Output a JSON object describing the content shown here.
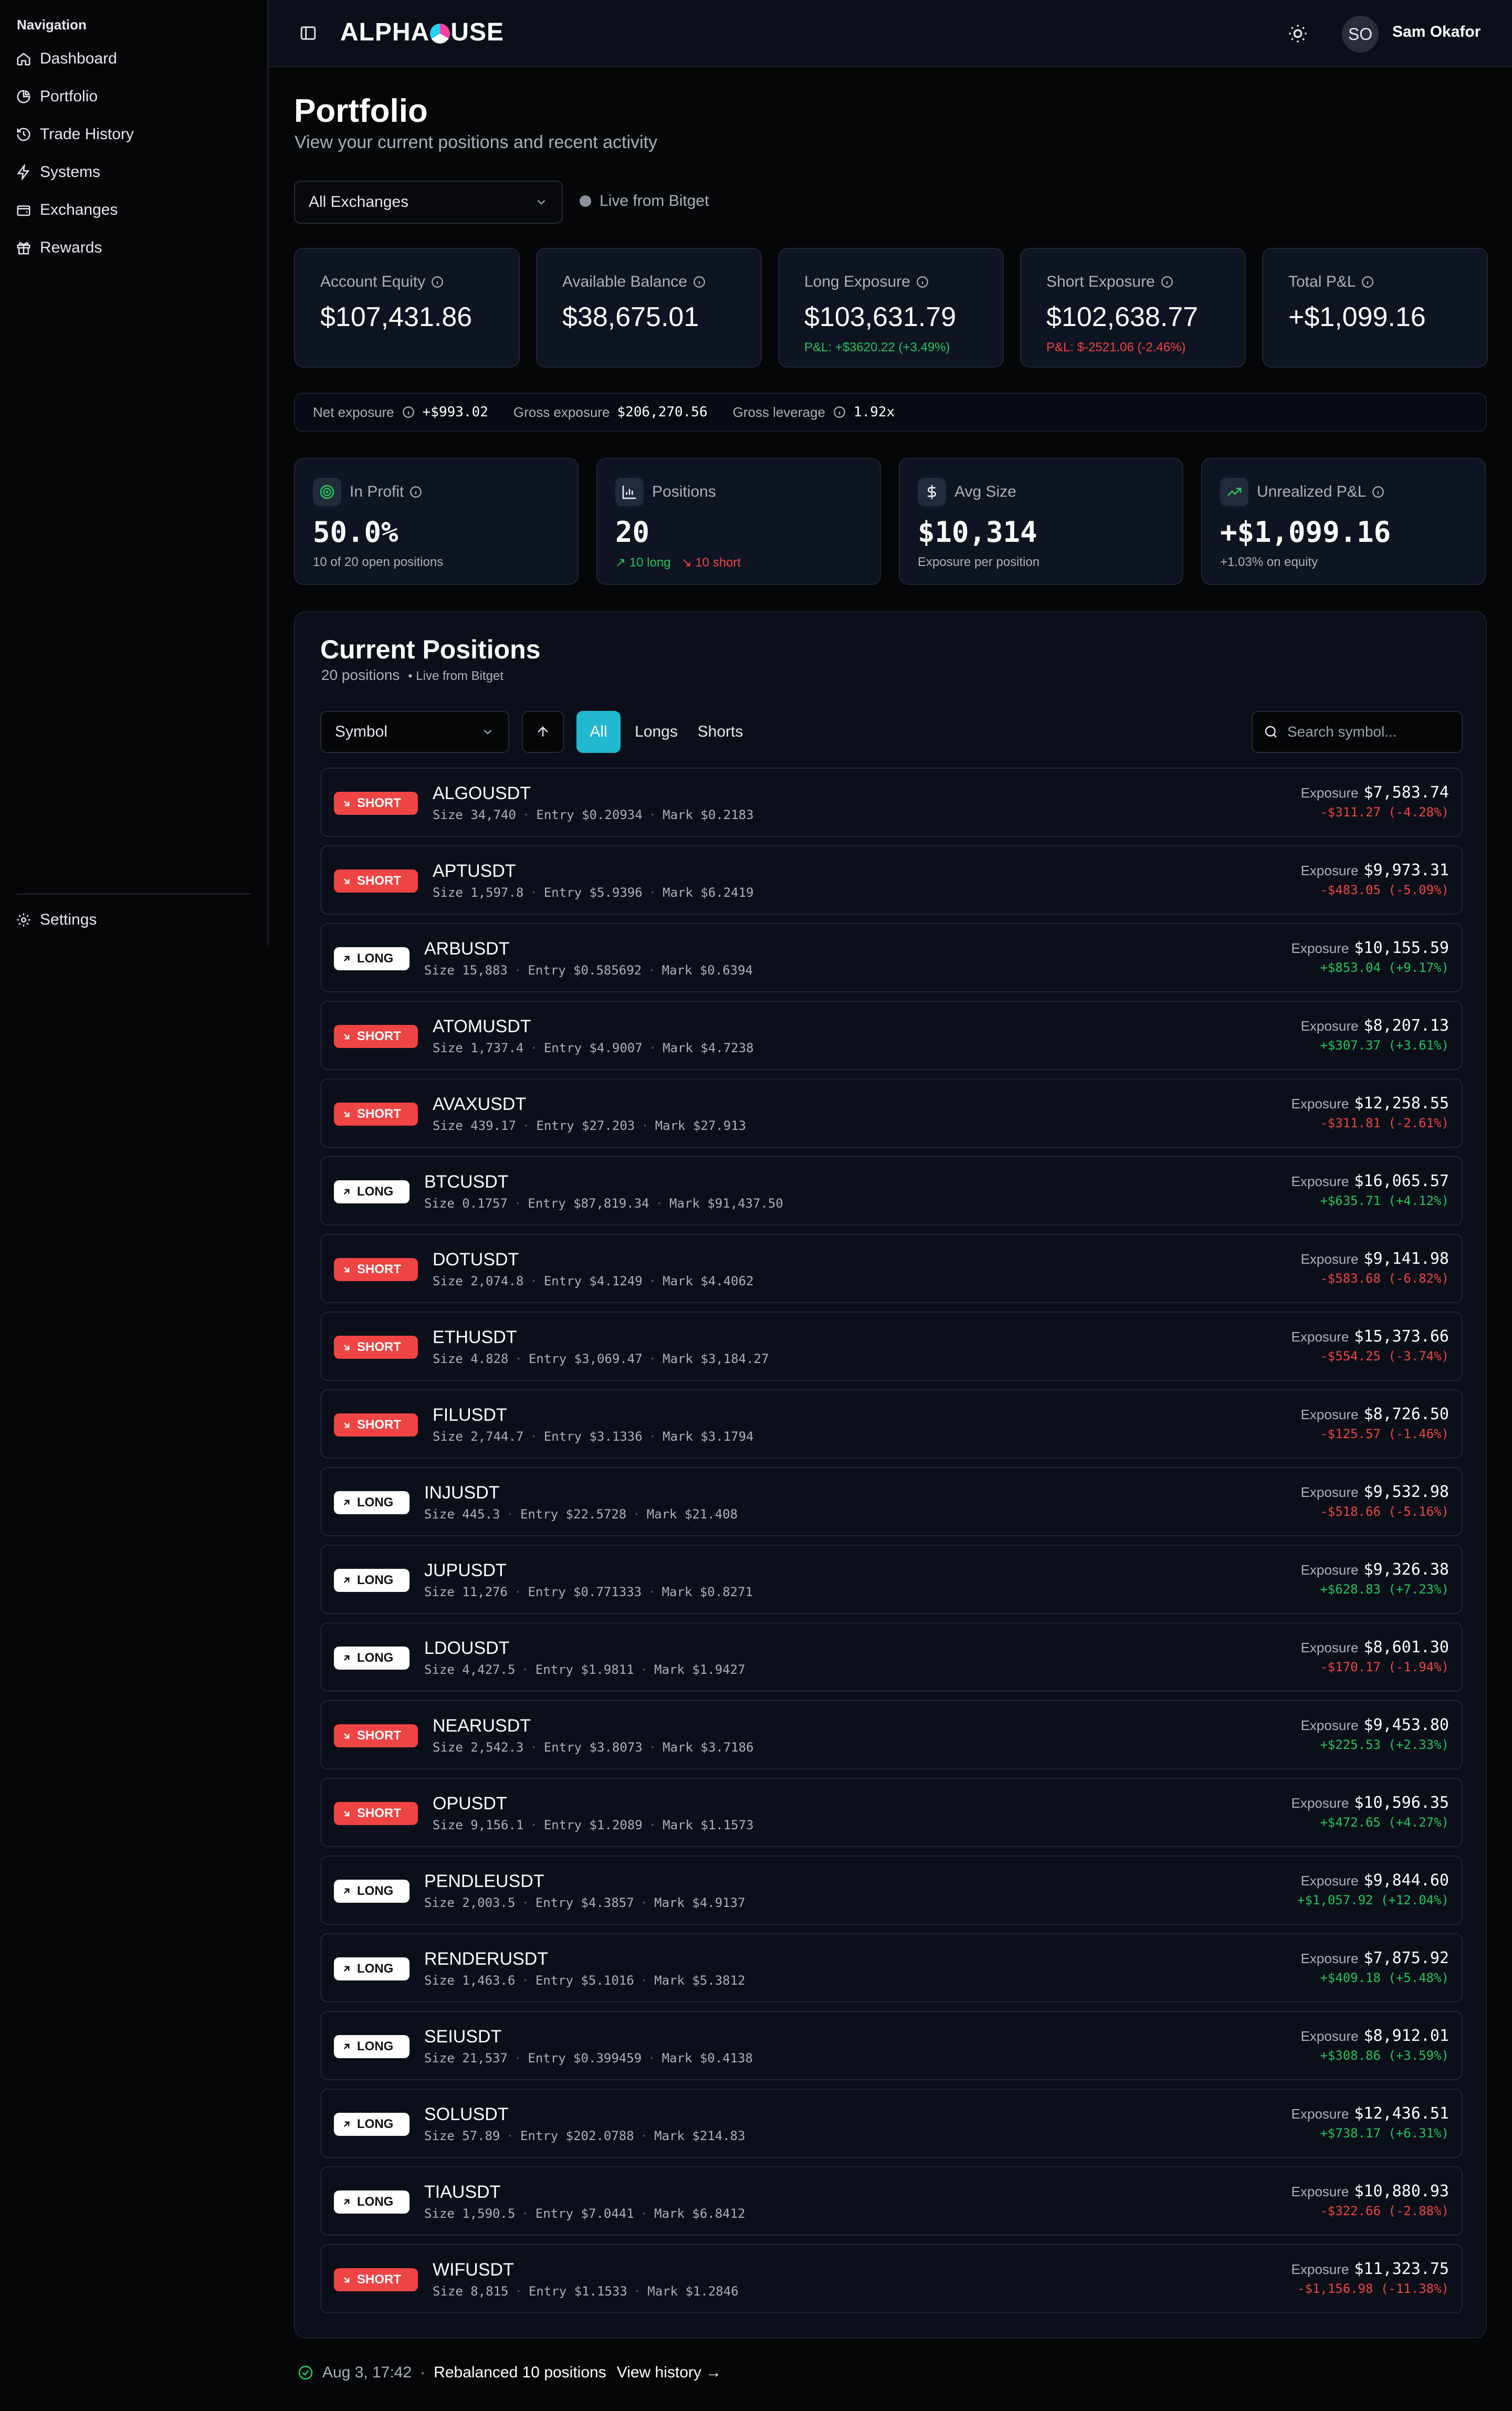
{
  "sidebar": {
    "heading": "Navigation",
    "items": [
      {
        "label": "Dashboard",
        "icon": "home-icon"
      },
      {
        "label": "Portfolio",
        "icon": "pie-chart-icon"
      },
      {
        "label": "Trade History",
        "icon": "history-icon"
      },
      {
        "label": "Systems",
        "icon": "zap-icon"
      },
      {
        "label": "Exchanges",
        "icon": "wallet-icon"
      },
      {
        "label": "Rewards",
        "icon": "gift-icon"
      }
    ],
    "settings": "Settings"
  },
  "header": {
    "logo_left": "ALPHA",
    "logo_right": "USE",
    "avatar": "SO",
    "user": "Sam Okafor"
  },
  "page": {
    "title": "Portfolio",
    "subtitle": "View your current positions and recent activity",
    "exchange_select": "All Exchanges",
    "live": "Live from Bitget"
  },
  "stats": [
    {
      "label": "Account Equity",
      "value": "$107,431.86",
      "sub": ""
    },
    {
      "label": "Available Balance",
      "value": "$38,675.01",
      "sub": ""
    },
    {
      "label": "Long Exposure",
      "value": "$103,631.79",
      "sub": "P&L: +$3620.22 (+3.49%)"
    },
    {
      "label": "Short Exposure",
      "value": "$102,638.77",
      "sub": "P&L: $-2521.06 (-2.46%)"
    },
    {
      "label": "Total P&L",
      "value": "+$1,099.16",
      "sub": ""
    }
  ],
  "exposure": {
    "net_label": "Net exposure",
    "net_value": "+$993.02",
    "gross_label": "Gross exposure",
    "gross_value": "$206,270.56",
    "lev_label": "Gross leverage",
    "lev_value": "1.92x"
  },
  "metrics": {
    "profit": {
      "label": "In Profit",
      "value": "50.0%",
      "note": "10 of 20 open positions"
    },
    "positions": {
      "label": "Positions",
      "value": "20",
      "long": "10 long",
      "short": "10 short"
    },
    "avg": {
      "label": "Avg Size",
      "value": "$10,314",
      "note": "Exposure per position"
    },
    "unreal": {
      "label": "Unrealized P&L",
      "value": "+$1,099.16",
      "note": "+1.03% on equity"
    }
  },
  "positions_panel": {
    "title": "Current Positions",
    "count": "20 positions",
    "live": "• Live from Bitget",
    "sort": "Symbol",
    "filters": [
      "All",
      "Longs",
      "Shorts"
    ],
    "search_placeholder": "Search symbol...",
    "exposure_label": "Exposure"
  },
  "positions": [
    {
      "side": "SHORT",
      "symbol": "ALGOUSDT",
      "size": "Size 34,740",
      "entry": "Entry $0.20934",
      "mark": "Mark $0.2183",
      "exposure": "$7,583.74",
      "pnl": "-$311.27 (-4.28%)"
    },
    {
      "side": "SHORT",
      "symbol": "APTUSDT",
      "size": "Size 1,597.8",
      "entry": "Entry $5.9396",
      "mark": "Mark $6.2419",
      "exposure": "$9,973.31",
      "pnl": "-$483.05 (-5.09%)"
    },
    {
      "side": "LONG",
      "symbol": "ARBUSDT",
      "size": "Size 15,883",
      "entry": "Entry $0.585692",
      "mark": "Mark $0.6394",
      "exposure": "$10,155.59",
      "pnl": "+$853.04 (+9.17%)"
    },
    {
      "side": "SHORT",
      "symbol": "ATOMUSDT",
      "size": "Size 1,737.4",
      "entry": "Entry $4.9007",
      "mark": "Mark $4.7238",
      "exposure": "$8,207.13",
      "pnl": "+$307.37 (+3.61%)"
    },
    {
      "side": "SHORT",
      "symbol": "AVAXUSDT",
      "size": "Size 439.17",
      "entry": "Entry $27.203",
      "mark": "Mark $27.913",
      "exposure": "$12,258.55",
      "pnl": "-$311.81 (-2.61%)"
    },
    {
      "side": "LONG",
      "symbol": "BTCUSDT",
      "size": "Size 0.1757",
      "entry": "Entry $87,819.34",
      "mark": "Mark $91,437.50",
      "exposure": "$16,065.57",
      "pnl": "+$635.71 (+4.12%)"
    },
    {
      "side": "SHORT",
      "symbol": "DOTUSDT",
      "size": "Size 2,074.8",
      "entry": "Entry $4.1249",
      "mark": "Mark $4.4062",
      "exposure": "$9,141.98",
      "pnl": "-$583.68 (-6.82%)"
    },
    {
      "side": "SHORT",
      "symbol": "ETHUSDT",
      "size": "Size 4.828",
      "entry": "Entry $3,069.47",
      "mark": "Mark $3,184.27",
      "exposure": "$15,373.66",
      "pnl": "-$554.25 (-3.74%)"
    },
    {
      "side": "SHORT",
      "symbol": "FILUSDT",
      "size": "Size 2,744.7",
      "entry": "Entry $3.1336",
      "mark": "Mark $3.1794",
      "exposure": "$8,726.50",
      "pnl": "-$125.57 (-1.46%)"
    },
    {
      "side": "LONG",
      "symbol": "INJUSDT",
      "size": "Size 445.3",
      "entry": "Entry $22.5728",
      "mark": "Mark $21.408",
      "exposure": "$9,532.98",
      "pnl": "-$518.66 (-5.16%)"
    },
    {
      "side": "LONG",
      "symbol": "JUPUSDT",
      "size": "Size 11,276",
      "entry": "Entry $0.771333",
      "mark": "Mark $0.8271",
      "exposure": "$9,326.38",
      "pnl": "+$628.83 (+7.23%)"
    },
    {
      "side": "LONG",
      "symbol": "LDOUSDT",
      "size": "Size 4,427.5",
      "entry": "Entry $1.9811",
      "mark": "Mark $1.9427",
      "exposure": "$8,601.30",
      "pnl": "-$170.17 (-1.94%)"
    },
    {
      "side": "SHORT",
      "symbol": "NEARUSDT",
      "size": "Size 2,542.3",
      "entry": "Entry $3.8073",
      "mark": "Mark $3.7186",
      "exposure": "$9,453.80",
      "pnl": "+$225.53 (+2.33%)"
    },
    {
      "side": "SHORT",
      "symbol": "OPUSDT",
      "size": "Size 9,156.1",
      "entry": "Entry $1.2089",
      "mark": "Mark $1.1573",
      "exposure": "$10,596.35",
      "pnl": "+$472.65 (+4.27%)"
    },
    {
      "side": "LONG",
      "symbol": "PENDLEUSDT",
      "size": "Size 2,003.5",
      "entry": "Entry $4.3857",
      "mark": "Mark $4.9137",
      "exposure": "$9,844.60",
      "pnl": "+$1,057.92 (+12.04%)"
    },
    {
      "side": "LONG",
      "symbol": "RENDERUSDT",
      "size": "Size 1,463.6",
      "entry": "Entry $5.1016",
      "mark": "Mark $5.3812",
      "exposure": "$7,875.92",
      "pnl": "+$409.18 (+5.48%)"
    },
    {
      "side": "LONG",
      "symbol": "SEIUSDT",
      "size": "Size 21,537",
      "entry": "Entry $0.399459",
      "mark": "Mark $0.4138",
      "exposure": "$8,912.01",
      "pnl": "+$308.86 (+3.59%)"
    },
    {
      "side": "LONG",
      "symbol": "SOLUSDT",
      "size": "Size 57.89",
      "entry": "Entry $202.0788",
      "mark": "Mark $214.83",
      "exposure": "$12,436.51",
      "pnl": "+$738.17 (+6.31%)"
    },
    {
      "side": "LONG",
      "symbol": "TIAUSDT",
      "size": "Size 1,590.5",
      "entry": "Entry $7.0441",
      "mark": "Mark $6.8412",
      "exposure": "$10,880.93",
      "pnl": "-$322.66 (-2.88%)"
    },
    {
      "side": "SHORT",
      "symbol": "WIFUSDT",
      "size": "Size 8,815",
      "entry": "Entry $1.1533",
      "mark": "Mark $1.2846",
      "exposure": "$11,323.75",
      "pnl": "-$1,156.98 (-11.38%)"
    }
  ],
  "footer": {
    "time": "Aug 3, 17:42",
    "sep": "·",
    "text": "Rebalanced 10 positions",
    "link": "View history →"
  },
  "colors": {
    "accent": "#22b8cf",
    "green": "#22c55e",
    "red": "#ef4444"
  }
}
